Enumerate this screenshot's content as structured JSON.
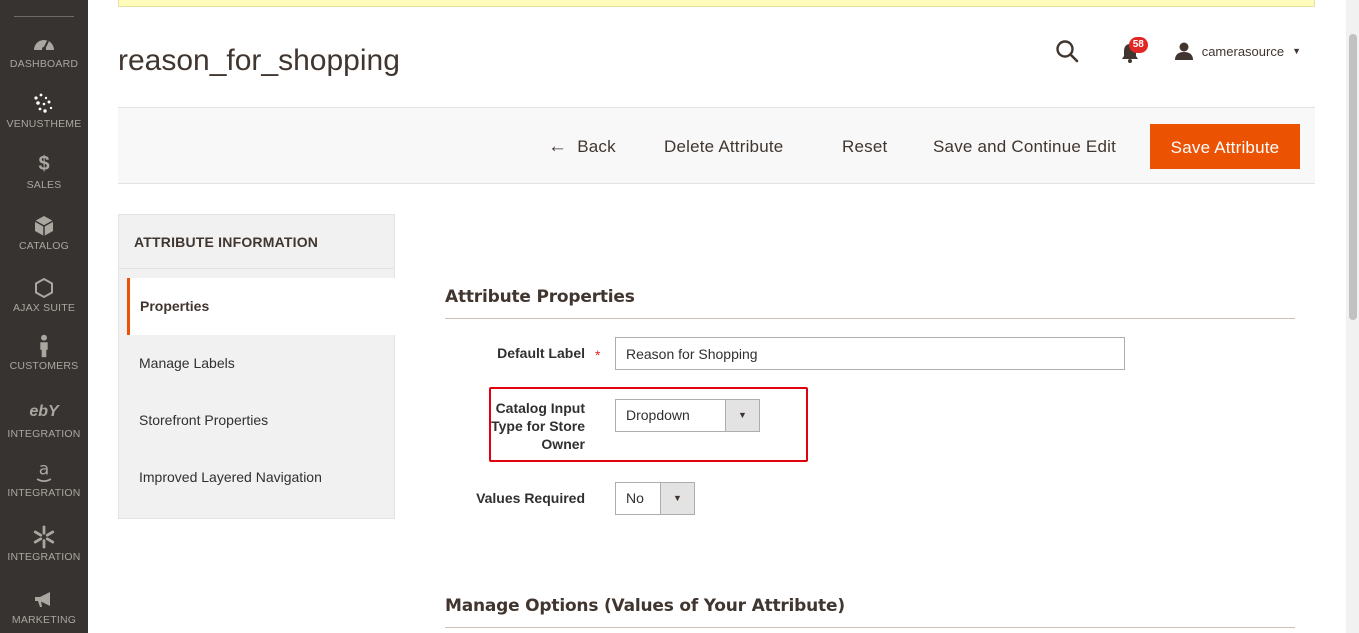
{
  "sidebar": {
    "items": [
      {
        "label": "DASHBOARD",
        "icon": "dashboard-icon"
      },
      {
        "label": "VENUSTHEME",
        "icon": "venustheme-icon"
      },
      {
        "label": "SALES",
        "icon": "dollar-icon"
      },
      {
        "label": "CATALOG",
        "icon": "box-icon"
      },
      {
        "label": "AJAX SUITE",
        "icon": "hexagon-icon"
      },
      {
        "label": "CUSTOMERS",
        "icon": "person-icon"
      },
      {
        "label": "INTEGRATION",
        "icon": "ebay-icon"
      },
      {
        "label": "INTEGRATION",
        "icon": "amazon-icon"
      },
      {
        "label": "INTEGRATION",
        "icon": "walmart-spark-icon"
      },
      {
        "label": "MARKETING",
        "icon": "megaphone-icon"
      }
    ]
  },
  "header": {
    "title": "reason_for_shopping",
    "notifications_count": "58",
    "username": "camerasource"
  },
  "toolbar": {
    "back_label": "Back",
    "delete_label": "Delete Attribute",
    "reset_label": "Reset",
    "save_continue_label": "Save and Continue Edit",
    "save_label": "Save Attribute",
    "primary_color": "#eb5202"
  },
  "tabs": {
    "title": "ATTRIBUTE INFORMATION",
    "items": [
      "Properties",
      "Manage Labels",
      "Storefront Properties",
      "Improved Layered Navigation"
    ],
    "active": "Properties"
  },
  "properties": {
    "section_title": "Attribute Properties",
    "default_label_label": "Default Label",
    "default_label_value": "Reason for Shopping",
    "catalog_input_label": "Catalog Input Type for Store Owner",
    "catalog_input_value": "Dropdown",
    "values_required_label": "Values Required",
    "values_required_value": "No"
  },
  "manage_options": {
    "section_title": "Manage Options (Values of Your Attribute)"
  }
}
